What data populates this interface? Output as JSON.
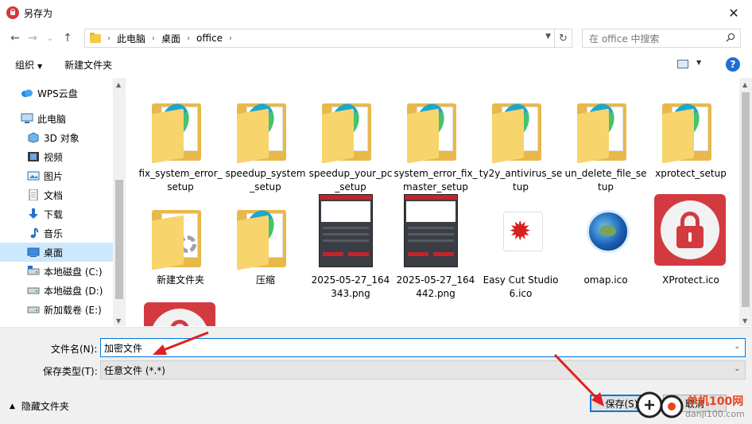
{
  "window": {
    "title": "另存为",
    "close_glyph": "✕"
  },
  "nav": {
    "back_glyph": "←",
    "forward_glyph": "→",
    "recent_glyph": "⌄",
    "up_glyph": "↑"
  },
  "address": {
    "crumbs": [
      "此电脑",
      "桌面",
      "office"
    ],
    "refresh_glyph": "↻"
  },
  "search": {
    "placeholder": "在 office 中搜索"
  },
  "toolbar": {
    "organize": "组织",
    "new_folder": "新建文件夹",
    "help": "?"
  },
  "sidebar": {
    "items": [
      {
        "label": "WPS云盘",
        "icon": "cloud-icon"
      },
      {
        "label": "此电脑",
        "icon": "computer-icon"
      },
      {
        "label": "3D 对象",
        "icon": "cube-icon"
      },
      {
        "label": "视频",
        "icon": "video-icon"
      },
      {
        "label": "图片",
        "icon": "picture-icon"
      },
      {
        "label": "文档",
        "icon": "document-icon"
      },
      {
        "label": "下载",
        "icon": "download-icon"
      },
      {
        "label": "音乐",
        "icon": "music-icon"
      },
      {
        "label": "桌面",
        "icon": "desktop-icon",
        "selected": true
      },
      {
        "label": "本地磁盘 (C:)",
        "icon": "drive-icon"
      },
      {
        "label": "本地磁盘 (D:)",
        "icon": "drive-icon"
      },
      {
        "label": "新加载卷 (E:)",
        "icon": "drive-icon"
      }
    ]
  },
  "files": [
    {
      "name": "fix_system_error_setup",
      "kind": "edge-folder"
    },
    {
      "name": "speedup_system_setup",
      "kind": "edge-folder"
    },
    {
      "name": "speedup_your_pc_setup",
      "kind": "edge-folder"
    },
    {
      "name": "system_error_fix_master_setup",
      "kind": "edge-folder"
    },
    {
      "name": "ty2y_antivirus_setup",
      "kind": "edge-folder"
    },
    {
      "name": "un_delete_file_setup",
      "kind": "edge-folder"
    },
    {
      "name": "xprotect_setup",
      "kind": "edge-folder"
    },
    {
      "name": "新建文件夹",
      "kind": "gear-folder"
    },
    {
      "name": "压缩",
      "kind": "edge-folder"
    },
    {
      "name": "2025-05-27_164343.png",
      "kind": "screenshot"
    },
    {
      "name": "2025-05-27_164442.png",
      "kind": "screenshot"
    },
    {
      "name": "Easy Cut Studio 6.ico",
      "kind": "maple-icon"
    },
    {
      "name": "omap.ico",
      "kind": "globe-icon"
    },
    {
      "name": "XProtect.ico",
      "kind": "lock-icon"
    },
    {
      "name": "",
      "kind": "lock-icon"
    }
  ],
  "form": {
    "filename_label": "文件名(N):",
    "filename_value": "加密文件",
    "filetype_label": "保存类型(T):",
    "filetype_value": "任意文件 (*.*)",
    "hide_folders": "隐藏文件夹",
    "save": "保存(S)",
    "cancel": "取消"
  },
  "watermark": {
    "site": "单机100网",
    "url": "danji100.com"
  },
  "colors": {
    "accent": "#0078d7",
    "selected": "#cce8ff",
    "annotation_arrow": "#e02020"
  }
}
